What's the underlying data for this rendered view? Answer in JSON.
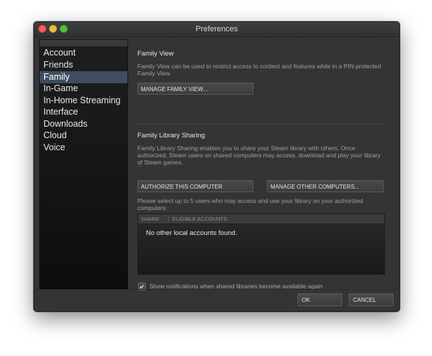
{
  "window": {
    "title": "Preferences"
  },
  "sidebar": {
    "items": [
      {
        "label": "Account"
      },
      {
        "label": "Friends"
      },
      {
        "label": "Family",
        "active": true
      },
      {
        "label": "In-Game"
      },
      {
        "label": "In-Home Streaming"
      },
      {
        "label": "Interface"
      },
      {
        "label": "Downloads"
      },
      {
        "label": "Cloud"
      },
      {
        "label": "Voice"
      }
    ]
  },
  "family_view": {
    "heading": "Family View",
    "description_line1": "Family View can be used to restrict access to content and features while in a PIN-protected",
    "description_line2": "Family View.",
    "manage_button": "MANAGE FAMILY VIEW..."
  },
  "library_sharing": {
    "heading": "Family Library Sharing",
    "description_line1": "Family Library Sharing enables you to share your Steam library with others. Once",
    "description_line2": "authorized, Steam users on shared computers may access, download and play your library",
    "description_line3": "of Steam games.",
    "ellipsis": "..",
    "authorize_button": "AUTHORIZE THIS COMPUTER",
    "manage_other_button": "MANAGE OTHER COMPUTERS...",
    "select_text_line1": "Please select up to 5 users who may access and use your library on your authorized",
    "select_text_line2": "computers:",
    "table": {
      "columns": [
        "SHARE",
        "ELIGIBLE ACCOUNTS"
      ],
      "empty_message": "No other local accounts found."
    },
    "notify_checkbox": {
      "label": "Show notifications when shared libraries become available again",
      "checked": true,
      "glyph": "✔"
    }
  },
  "footer": {
    "ok_label": "OK",
    "cancel_label": "CANCEL"
  },
  "colors": {
    "window_bg": "#333436",
    "sidebar_active": "#3f4d62",
    "text_muted": "#9fa0a1"
  }
}
